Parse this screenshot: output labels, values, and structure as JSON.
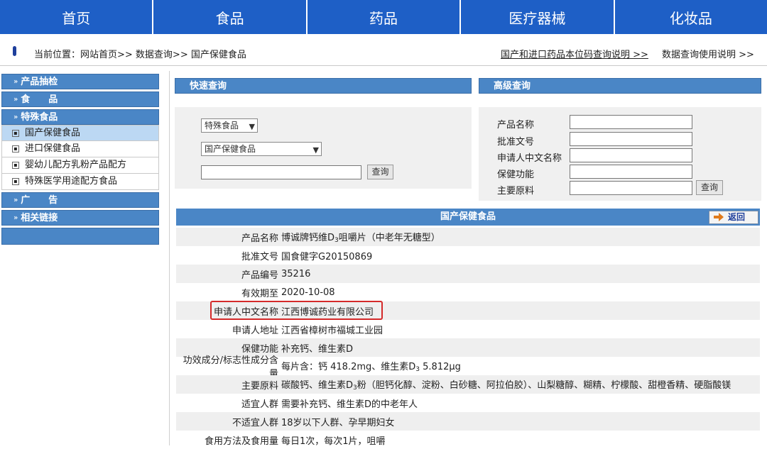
{
  "nav": [
    "首页",
    "食品",
    "药品",
    "医疗器械",
    "化妆品"
  ],
  "breadcrumb": {
    "label": "当前位置：",
    "path": "网站首页>> 数据查询>> 国产保健食品",
    "link1": "国产和进口药品本位码查询说明 >>",
    "link2": "数据查询使用说明 >>"
  },
  "sidebar": {
    "heads": [
      "产品抽检",
      "食　　品",
      "特殊食品",
      "广　　告",
      "相关链接"
    ],
    "items": [
      "国产保健食品",
      "进口保健食品",
      "婴幼儿配方乳粉产品配方",
      "特殊医学用途配方食品"
    ]
  },
  "quick": {
    "title": "快速查询",
    "select1": "特殊食品",
    "select2": "国产保健食品",
    "button": "查询"
  },
  "advanced": {
    "title": "高级查询",
    "labels": [
      "产品名称",
      "批准文号",
      "申请人中文名称",
      "保健功能",
      "主要原料"
    ],
    "button": "查询"
  },
  "detail": {
    "title": "国产保健食品",
    "back": "返回",
    "rows": [
      {
        "k": "产品名称",
        "v1": "博诚牌钙维D",
        "sub": "3",
        "v2": "咀嚼片（中老年无糖型）"
      },
      {
        "k": "批准文号",
        "v1": "国食健字G20150869"
      },
      {
        "k": "产品编号",
        "v1": "35216"
      },
      {
        "k": "有效期至",
        "v1": "2020-10-08"
      },
      {
        "k": "申请人中文名称",
        "v1": "江西博诚药业有限公司"
      },
      {
        "k": "申请人地址",
        "v1": "江西省樟树市福城工业园"
      },
      {
        "k": "保健功能",
        "v1": "补充钙、维生素D"
      },
      {
        "k": "功效成分/标志性成分含量",
        "v1": "每片含：钙 418.2mg、维生素D",
        "sub": "3",
        "v2": " 5.812μg"
      },
      {
        "k": "主要原料",
        "v1": "碳酸钙、维生素D",
        "sub": "3",
        "v2": "粉（胆钙化醇、淀粉、白砂糖、阿拉伯胶）、山梨糖醇、糊精、柠檬酸、甜橙香精、硬脂酸镁"
      },
      {
        "k": "适宜人群",
        "v1": "需要补充钙、维生素D的中老年人"
      },
      {
        "k": "不适宜人群",
        "v1": "18岁以下人群、孕早期妇女"
      },
      {
        "k": "食用方法及食用量",
        "v1": "每日1次，每次1片，咀嚼"
      }
    ]
  },
  "colors": {
    "nav": "#1e5fc6",
    "panel": "#4a86c6",
    "highlight": "#d42a2a"
  }
}
